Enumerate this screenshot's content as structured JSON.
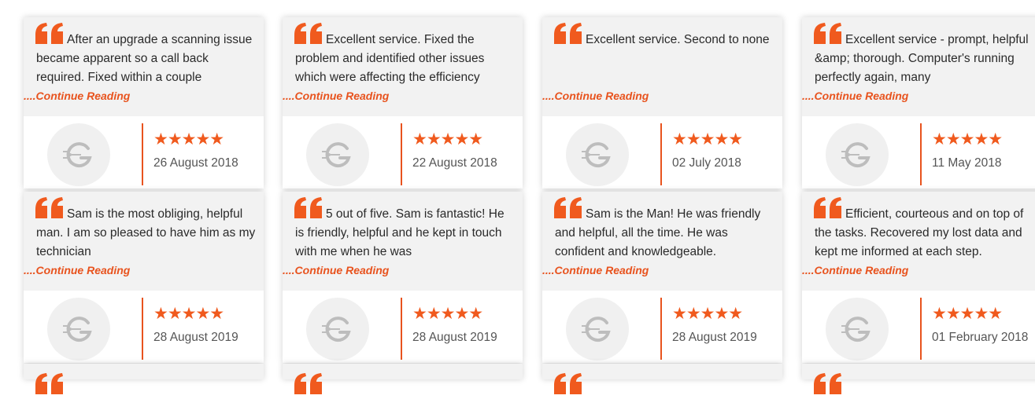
{
  "read_more_label": "....Continue Reading",
  "accent_color": "#f05a1e",
  "quote_icon": "quote-icon",
  "avatar_icon": "g-logo-icon",
  "rows": [
    [
      {
        "text": "After an upgrade a scanning issue became apparent so a call back required. Fixed within a couple",
        "stars": "★★★★★",
        "rating": 5,
        "date": "26 August 2018"
      },
      {
        "text": "Excellent service. Fixed the problem and identified other issues which were affecting the efficiency",
        "stars": "★★★★★",
        "rating": 5,
        "date": "22 August 2018"
      },
      {
        "text": "Excellent service. Second to none",
        "stars": "★★★★★",
        "rating": 5,
        "date": "02 July 2018"
      },
      {
        "text": "Excellent service - prompt, helpful &amp; thorough. Computer's running perfectly again, many",
        "stars": "★★★★★",
        "rating": 5,
        "date": "11 May 2018"
      }
    ],
    [
      {
        "text": "Sam is the most obliging, helpful man. I am so pleased to have him as my technician",
        "stars": "★★★★★",
        "rating": 5,
        "date": "28 August 2019"
      },
      {
        "text": "5 out of five. Sam is fantastic! He is friendly, helpful and he kept in touch with me when he was",
        "stars": "★★★★★",
        "rating": 5,
        "date": "28 August 2019"
      },
      {
        "text": "Sam is the Man! He was friendly and helpful, all the time. He was confident and knowledgeable.",
        "stars": "★★★★★",
        "rating": 5,
        "date": "28 August 2019"
      },
      {
        "text": "Efficient, courteous and on top of the tasks. Recovered my lost data and kept me informed at each step.",
        "stars": "★★★★★",
        "rating": 5,
        "date": "01 February 2018"
      }
    ]
  ]
}
